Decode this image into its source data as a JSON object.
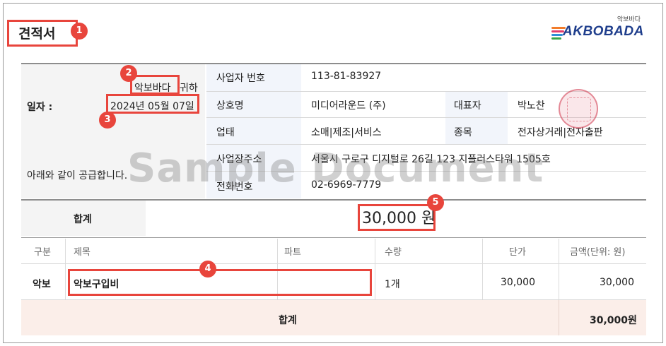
{
  "document": {
    "title": "견적서",
    "date_label": "일자 :",
    "recipient": "악보바다",
    "recipient_suffix": "귀하",
    "date_value": "2024년 05월 07일",
    "notice": "아래와 같이 공급합니다."
  },
  "logo": {
    "sub": "악보바다",
    "main": "AKBOBADA",
    "colors": [
      "#f27c2a",
      "#e23e6e",
      "#2f8fd8",
      "#37a649"
    ]
  },
  "supplier": {
    "reg_no_label": "사업자 번호",
    "reg_no": "113-81-83927",
    "company_label": "상호명",
    "company": "미디어라운드 (주)",
    "ceo_label": "대표자",
    "ceo": "박노찬",
    "business_label": "업태",
    "business": "소매|제조|서비스",
    "type_label": "종목",
    "type": "전자상거래|전자출판",
    "address_label": "사업장주소",
    "address": "서울시 구로구 디지털로 26길 123 지플러스타워 1505호",
    "phone_label": "전화번호",
    "phone": "02-6969-7779"
  },
  "total": {
    "label": "합계",
    "amount": "30,000 원"
  },
  "items": {
    "headers": [
      "구분",
      "제목",
      "파트",
      "수량",
      "단가",
      "금액(단위: 원)"
    ],
    "rows": [
      {
        "category": "악보",
        "title": "악보구입비",
        "part": "",
        "qty": "1개",
        "unit_price": "30,000",
        "amount": "30,000"
      }
    ],
    "footer_label": "합계",
    "footer_amount": "30,000원"
  },
  "watermark": "Sample Document",
  "badges": [
    "1",
    "2",
    "3",
    "4",
    "5"
  ],
  "accent_color": "#e8453c"
}
